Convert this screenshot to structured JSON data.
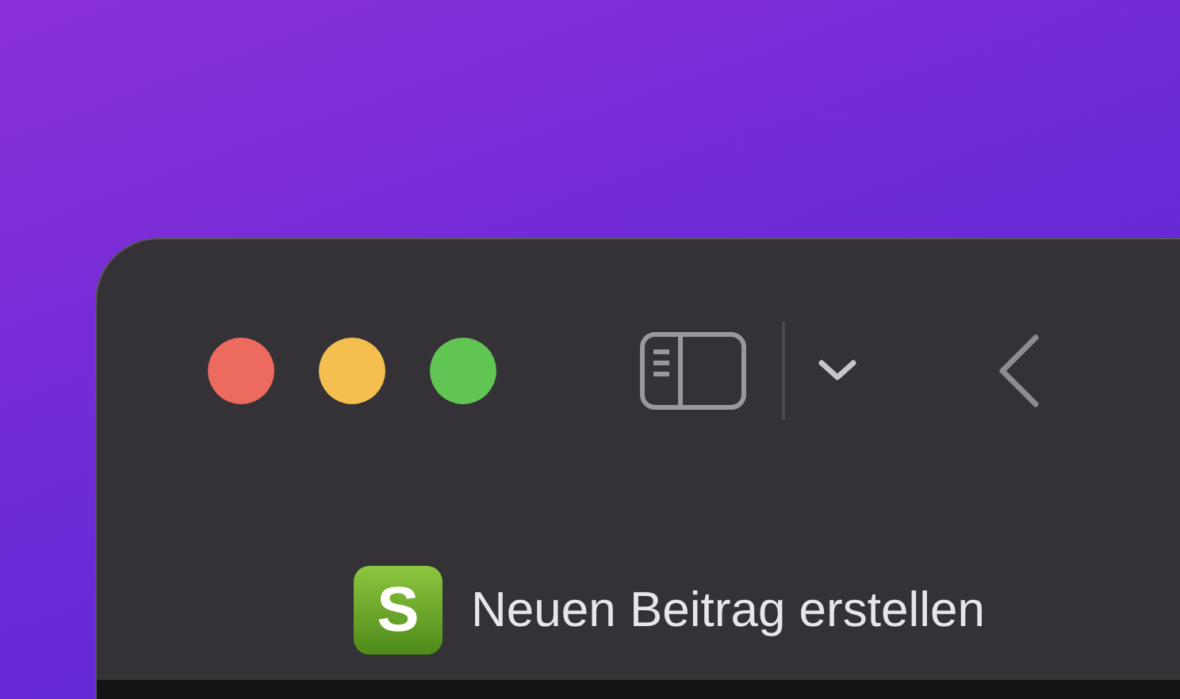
{
  "window": {
    "traffic_lights": [
      {
        "color": "#ed6a5e"
      },
      {
        "color": "#f5bf4f"
      },
      {
        "color": "#61c554"
      }
    ]
  },
  "tab": {
    "favicon_letter": "S",
    "title": "Neuen Beitrag erstellen"
  }
}
